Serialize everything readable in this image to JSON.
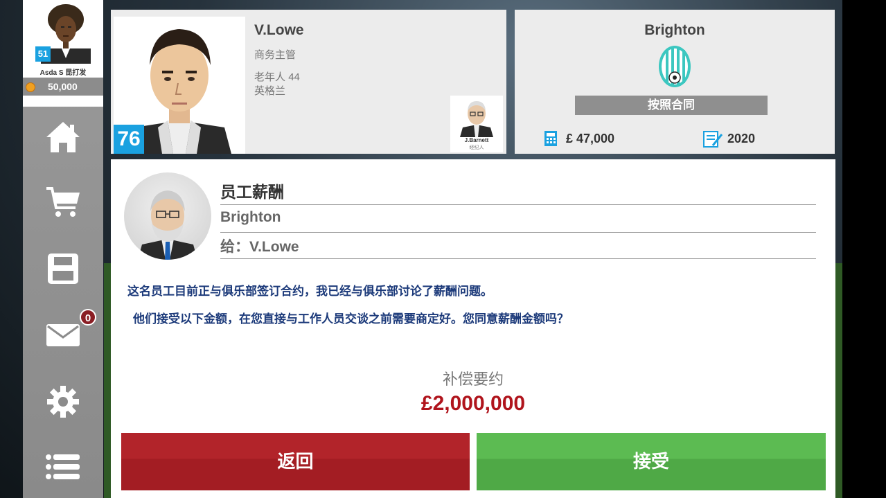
{
  "sidebar": {
    "level": "51",
    "manager_name": "Asda S 昆打发",
    "coins": "50,000",
    "nav": [
      "home-icon",
      "cart-icon",
      "save-icon",
      "mail-icon",
      "settings-icon",
      "menu-icon"
    ],
    "mail_count": "0"
  },
  "player": {
    "name": "V.Lowe",
    "role": "商务主管",
    "age_label": "老年人",
    "age": "44",
    "nation": "英格兰",
    "rating": "76",
    "agent_name": "J.Barnett",
    "agent_role": "经纪人"
  },
  "club": {
    "name": "Brighton",
    "contract_button": "按照合同",
    "wage": "£ 47,000",
    "contract_year": "2020"
  },
  "message": {
    "title": "员工薪酬",
    "from": "Brighton",
    "to_label": "给：",
    "to": "V.Lowe",
    "body_line1": "这名员工目前正与俱乐部签订合约，我已经与俱乐部讨论了薪酬问题。",
    "body_line2": "他们接受以下金额，在您直接与工作人员交谈之前需要商定好。您同意薪酬金额吗？",
    "compensation_label": "补偿要约",
    "compensation_value": "£2,000,000",
    "back_label": "返回",
    "accept_label": "接受"
  },
  "colors": {
    "accent_blue": "#1aa1e0",
    "back_red": "#b2242a",
    "accept_green": "#5cbb52",
    "offer_red": "#b0141c"
  }
}
